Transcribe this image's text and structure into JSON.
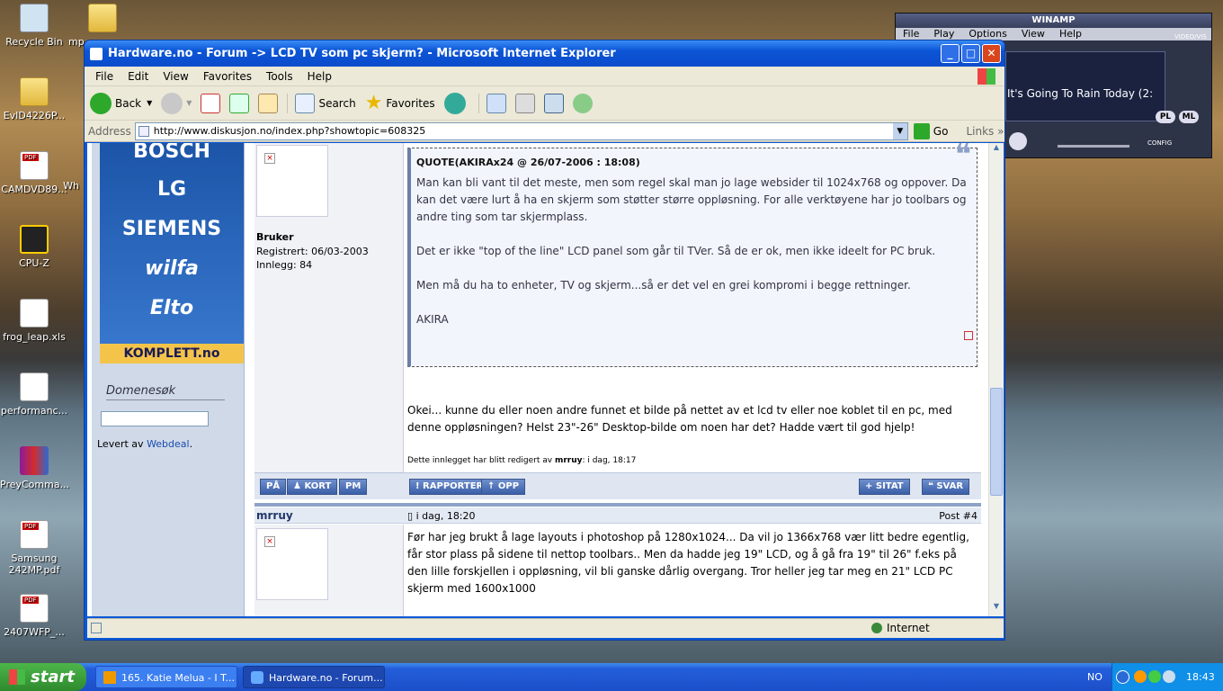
{
  "desktop": {
    "icons": [
      "Recycle Bin",
      "mp",
      "EvID4226P...",
      "CAMDVD89...",
      "Wh",
      "CPU-Z",
      "frog_leap.xls",
      "performanc...",
      "PreyComma...",
      "Samsung 242MP.pdf",
      "2407WFP_..."
    ]
  },
  "winamp": {
    "title": "WINAMP",
    "menu": [
      "File",
      "Play",
      "Options",
      "View",
      "Help"
    ],
    "song": "It's Going To Rain Today (2:",
    "buttons": [
      "PL",
      "ML",
      "CONFIG",
      "VIDEO/VIS"
    ]
  },
  "ie": {
    "title": "Hardware.no - Forum -> LCD TV som pc skjerm? - Microsoft Internet Explorer",
    "menu": [
      "File",
      "Edit",
      "View",
      "Favorites",
      "Tools",
      "Help"
    ],
    "toolbar": {
      "back": "Back",
      "search": "Search",
      "favorites": "Favorites"
    },
    "address_label": "Address",
    "address": "http://www.diskusjon.no/index.php?showtopic=608325",
    "go": "Go",
    "links": "Links",
    "status_zone": "Internet"
  },
  "sidebar": {
    "brands": [
      "BOSCH",
      "LG",
      "SIEMENS",
      "wilfa",
      "Elto"
    ],
    "komplett": "KOMPLETT.no",
    "domene_title": "Domenesøk",
    "levert_prefix": "Levert av ",
    "levert_link": "Webdeal",
    "levert_suffix": "."
  },
  "post3": {
    "role": "Bruker",
    "registered": "Registrert: 06/03-2003",
    "posts": "Innlegg: 84",
    "quote_header": "QUOTE(AKIRAx24 @ 26/07-2006 : 18:08)",
    "quote_p1": "Man kan bli vant til det meste, men som regel skal man jo lage websider til 1024x768 og oppover. Da kan det være lurt å ha en skjerm som støtter større oppløsning. For alle verktøyene har jo toolbars og andre ting som tar skjermplass.",
    "quote_p2": "Det er ikke \"top of the line\" LCD panel som går til TVer. Så de er ok, men ikke ideelt for PC bruk.",
    "quote_p3": "Men må du ha to enheter, TV og skjerm...så er det vel en grei kompromi i begge rettninger.",
    "quote_sig": "AKIRA",
    "body": "Okei... kunne du eller noen andre funnet et bilde på nettet av et lcd tv eller noe koblet til en pc, med denne oppløsningen? Helst 23\"-26\" Desktop-bilde om noen har det? Hadde vært til god hjelp!",
    "edited_prefix": "Dette innlegget har blitt redigert av ",
    "edited_user": "mrruy",
    "edited_suffix": ": i dag, 18:17",
    "buttons": {
      "pa": "PÅ",
      "kort": "KORT",
      "pm": "PM",
      "rapporter": "RAPPORTER",
      "opp": "OPP",
      "sitat": "SITAT",
      "svar": "SVAR"
    }
  },
  "post4": {
    "user": "mrruy",
    "time": "i dag, 18:20",
    "post_num": "Post #4",
    "body": "Før har jeg brukt å lage layouts i photoshop på 1280x1024... Da vil jo 1366x768 vær litt bedre egentlig, får stor plass på sidene til nettop toolbars.. Men da hadde jeg 19\" LCD, og å gå fra 19\" til 26\" f.eks på den lille forskjellen i oppløsning, vil bli ganske dårlig overgang. Tror heller jeg tar meg en 21\" LCD PC skjerm med 1600x1000"
  },
  "taskbar": {
    "start": "start",
    "tasks": [
      "165. Katie Melua - I T...",
      "Hardware.no - Forum..."
    ],
    "lang": "NO",
    "clock": "18:43"
  }
}
